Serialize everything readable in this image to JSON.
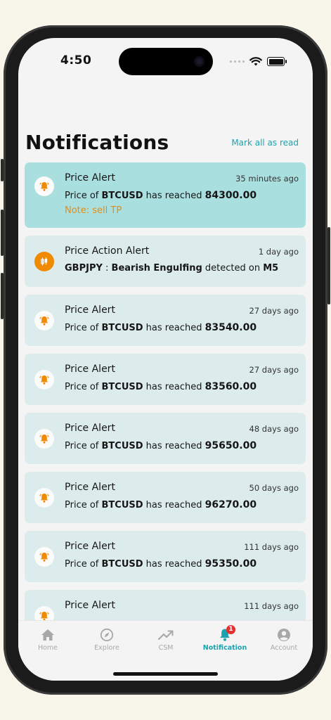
{
  "status_bar": {
    "time": "4:50"
  },
  "header": {
    "title": "Notifications",
    "mark_all_label": "Mark all as read"
  },
  "notifications": [
    {
      "type": "price",
      "title": "Price Alert",
      "time": "35 minutes ago",
      "prefix": "Price of ",
      "symbol": "BTCUSD",
      "middle": " has reached ",
      "value": "84300.00",
      "note": "Note: sell TP",
      "highlight": true
    },
    {
      "type": "action",
      "title": "Price Action Alert",
      "time": "1 day ago",
      "symbol": "GBPJPY",
      "sep": " : ",
      "pattern": "Bearish Engulfing",
      "middle": " detected on ",
      "timeframe": "M5"
    },
    {
      "type": "price",
      "title": "Price Alert",
      "time": "27 days ago",
      "prefix": "Price of ",
      "symbol": "BTCUSD",
      "middle": " has reached ",
      "value": "83540.00"
    },
    {
      "type": "price",
      "title": "Price Alert",
      "time": "27 days ago",
      "prefix": "Price of ",
      "symbol": "BTCUSD",
      "middle": " has reached ",
      "value": "83560.00"
    },
    {
      "type": "price",
      "title": "Price Alert",
      "time": "48 days ago",
      "prefix": "Price of ",
      "symbol": "BTCUSD",
      "middle": " has reached ",
      "value": "95650.00"
    },
    {
      "type": "price",
      "title": "Price Alert",
      "time": "50 days ago",
      "prefix": "Price of ",
      "symbol": "BTCUSD",
      "middle": " has reached ",
      "value": "96270.00"
    },
    {
      "type": "price",
      "title": "Price Alert",
      "time": "111 days ago",
      "prefix": "Price of ",
      "symbol": "BTCUSD",
      "middle": " has reached ",
      "value": "95350.00"
    },
    {
      "type": "price",
      "title": "Price Alert",
      "time": "111 days ago"
    }
  ],
  "bottom_nav": {
    "items": [
      {
        "label": "Home",
        "icon": "home-icon"
      },
      {
        "label": "Explore",
        "icon": "compass-icon"
      },
      {
        "label": "CSM",
        "icon": "trend-icon"
      },
      {
        "label": "Notification",
        "icon": "bell-icon",
        "active": true,
        "badge": "1"
      },
      {
        "label": "Account",
        "icon": "account-icon"
      }
    ]
  },
  "colors": {
    "accent": "#1aa3ad",
    "card_bg": "#dcecec",
    "card_highlight": "#aadfe0",
    "bell": "#f08a00",
    "note": "#e38c14",
    "badge": "#e53030"
  }
}
